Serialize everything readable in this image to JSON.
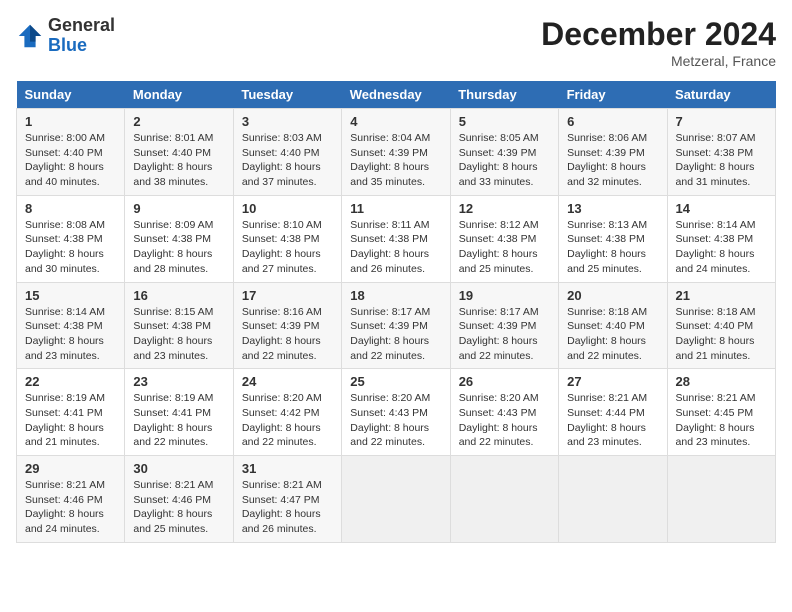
{
  "header": {
    "logo_line1": "General",
    "logo_line2": "Blue",
    "month_title": "December 2024",
    "location": "Metzeral, France"
  },
  "weekdays": [
    "Sunday",
    "Monday",
    "Tuesday",
    "Wednesday",
    "Thursday",
    "Friday",
    "Saturday"
  ],
  "weeks": [
    [
      {
        "day": "1",
        "info": "Sunrise: 8:00 AM\nSunset: 4:40 PM\nDaylight: 8 hours\nand 40 minutes."
      },
      {
        "day": "2",
        "info": "Sunrise: 8:01 AM\nSunset: 4:40 PM\nDaylight: 8 hours\nand 38 minutes."
      },
      {
        "day": "3",
        "info": "Sunrise: 8:03 AM\nSunset: 4:40 PM\nDaylight: 8 hours\nand 37 minutes."
      },
      {
        "day": "4",
        "info": "Sunrise: 8:04 AM\nSunset: 4:39 PM\nDaylight: 8 hours\nand 35 minutes."
      },
      {
        "day": "5",
        "info": "Sunrise: 8:05 AM\nSunset: 4:39 PM\nDaylight: 8 hours\nand 33 minutes."
      },
      {
        "day": "6",
        "info": "Sunrise: 8:06 AM\nSunset: 4:39 PM\nDaylight: 8 hours\nand 32 minutes."
      },
      {
        "day": "7",
        "info": "Sunrise: 8:07 AM\nSunset: 4:38 PM\nDaylight: 8 hours\nand 31 minutes."
      }
    ],
    [
      {
        "day": "8",
        "info": "Sunrise: 8:08 AM\nSunset: 4:38 PM\nDaylight: 8 hours\nand 30 minutes."
      },
      {
        "day": "9",
        "info": "Sunrise: 8:09 AM\nSunset: 4:38 PM\nDaylight: 8 hours\nand 28 minutes."
      },
      {
        "day": "10",
        "info": "Sunrise: 8:10 AM\nSunset: 4:38 PM\nDaylight: 8 hours\nand 27 minutes."
      },
      {
        "day": "11",
        "info": "Sunrise: 8:11 AM\nSunset: 4:38 PM\nDaylight: 8 hours\nand 26 minutes."
      },
      {
        "day": "12",
        "info": "Sunrise: 8:12 AM\nSunset: 4:38 PM\nDaylight: 8 hours\nand 25 minutes."
      },
      {
        "day": "13",
        "info": "Sunrise: 8:13 AM\nSunset: 4:38 PM\nDaylight: 8 hours\nand 25 minutes."
      },
      {
        "day": "14",
        "info": "Sunrise: 8:14 AM\nSunset: 4:38 PM\nDaylight: 8 hours\nand 24 minutes."
      }
    ],
    [
      {
        "day": "15",
        "info": "Sunrise: 8:14 AM\nSunset: 4:38 PM\nDaylight: 8 hours\nand 23 minutes."
      },
      {
        "day": "16",
        "info": "Sunrise: 8:15 AM\nSunset: 4:38 PM\nDaylight: 8 hours\nand 23 minutes."
      },
      {
        "day": "17",
        "info": "Sunrise: 8:16 AM\nSunset: 4:39 PM\nDaylight: 8 hours\nand 22 minutes."
      },
      {
        "day": "18",
        "info": "Sunrise: 8:17 AM\nSunset: 4:39 PM\nDaylight: 8 hours\nand 22 minutes."
      },
      {
        "day": "19",
        "info": "Sunrise: 8:17 AM\nSunset: 4:39 PM\nDaylight: 8 hours\nand 22 minutes."
      },
      {
        "day": "20",
        "info": "Sunrise: 8:18 AM\nSunset: 4:40 PM\nDaylight: 8 hours\nand 22 minutes."
      },
      {
        "day": "21",
        "info": "Sunrise: 8:18 AM\nSunset: 4:40 PM\nDaylight: 8 hours\nand 21 minutes."
      }
    ],
    [
      {
        "day": "22",
        "info": "Sunrise: 8:19 AM\nSunset: 4:41 PM\nDaylight: 8 hours\nand 21 minutes."
      },
      {
        "day": "23",
        "info": "Sunrise: 8:19 AM\nSunset: 4:41 PM\nDaylight: 8 hours\nand 22 minutes."
      },
      {
        "day": "24",
        "info": "Sunrise: 8:20 AM\nSunset: 4:42 PM\nDaylight: 8 hours\nand 22 minutes."
      },
      {
        "day": "25",
        "info": "Sunrise: 8:20 AM\nSunset: 4:43 PM\nDaylight: 8 hours\nand 22 minutes."
      },
      {
        "day": "26",
        "info": "Sunrise: 8:20 AM\nSunset: 4:43 PM\nDaylight: 8 hours\nand 22 minutes."
      },
      {
        "day": "27",
        "info": "Sunrise: 8:21 AM\nSunset: 4:44 PM\nDaylight: 8 hours\nand 23 minutes."
      },
      {
        "day": "28",
        "info": "Sunrise: 8:21 AM\nSunset: 4:45 PM\nDaylight: 8 hours\nand 23 minutes."
      }
    ],
    [
      {
        "day": "29",
        "info": "Sunrise: 8:21 AM\nSunset: 4:46 PM\nDaylight: 8 hours\nand 24 minutes."
      },
      {
        "day": "30",
        "info": "Sunrise: 8:21 AM\nSunset: 4:46 PM\nDaylight: 8 hours\nand 25 minutes."
      },
      {
        "day": "31",
        "info": "Sunrise: 8:21 AM\nSunset: 4:47 PM\nDaylight: 8 hours\nand 26 minutes."
      },
      {
        "day": "",
        "info": ""
      },
      {
        "day": "",
        "info": ""
      },
      {
        "day": "",
        "info": ""
      },
      {
        "day": "",
        "info": ""
      }
    ]
  ]
}
